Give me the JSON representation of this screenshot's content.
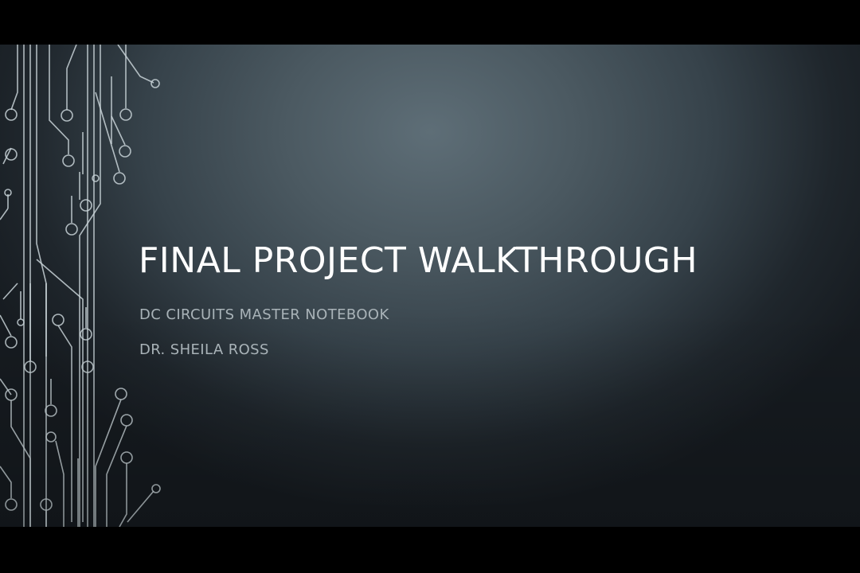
{
  "slide": {
    "title": "FINAL PROJECT WALKTHROUGH",
    "subtitle_line1": "DC CIRCUITS MASTER NOTEBOOK",
    "subtitle_line2": "DR. SHEILA ROSS"
  },
  "theme": {
    "letterbox_color": "#000000",
    "background_highlight": "#5e6e77",
    "background_dark": "#161b20",
    "title_color": "#ffffff",
    "subtitle_color": "#a9b3b8",
    "circuit_color": "#c9d3d8"
  },
  "decoration": {
    "icon": "circuit-trace-pattern"
  }
}
